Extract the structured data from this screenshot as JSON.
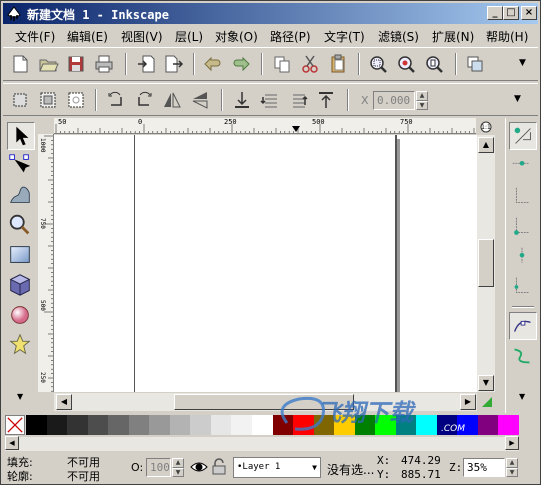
{
  "window": {
    "title": "新建文档 1 - Inkscape",
    "minimize_label": "_",
    "maximize_label": "□",
    "close_label": "×"
  },
  "menu": [
    "文件(F)",
    "编辑(E)",
    "视图(V)",
    "层(L)",
    "对象(O)",
    "路径(P)",
    "文字(T)",
    "滤镜(S)",
    "扩展(N)",
    "帮助(H)"
  ],
  "command_bar": {
    "icons": [
      "new-document-icon",
      "open-icon",
      "save-icon",
      "print-icon",
      "import-icon",
      "export-icon",
      "undo-icon",
      "redo-icon",
      "copy-icon",
      "cut-icon",
      "paste-icon",
      "zoom-selection-icon",
      "zoom-drawing-icon",
      "zoom-page-icon",
      "duplicate-icon"
    ],
    "overflow_label": "▼"
  },
  "tool_controls": {
    "icons": [
      "select-all-icon",
      "select-all-layers-icon",
      "deselect-icon",
      "rotate-ccw-icon",
      "rotate-cw-icon",
      "flip-horizontal-icon",
      "flip-vertical-icon",
      "lower-to-bottom-icon",
      "lower-icon",
      "raise-icon",
      "raise-to-top-icon"
    ],
    "x_label": "X",
    "x_value": "0.000",
    "overflow_label": "▼"
  },
  "toolbox": [
    "selector-tool-icon",
    "node-tool-icon",
    "tweak-tool-icon",
    "zoom-tool-icon",
    "rectangle-tool-icon",
    "3d-box-tool-icon",
    "ellipse-tool-icon",
    "star-tool-icon"
  ],
  "snapbar": [
    "snap-toggle-icon",
    "snap-bbox-icon",
    "snap-bbox-edge-icon",
    "snap-bbox-corner-icon",
    "snap-bbox-midpoint-icon",
    "snap-bbox-center-icon",
    "snap-nodes-icon",
    "snap-path-icon"
  ],
  "rulers": {
    "top_ticks": [
      "50",
      "0",
      "250",
      "500",
      "750"
    ],
    "left_ticks": [
      "1000",
      "750",
      "500",
      "250"
    ]
  },
  "palette": {
    "none_label": "X",
    "colors": [
      "#000000",
      "#1a1a1a",
      "#333333",
      "#4d4d4d",
      "#666666",
      "#808080",
      "#999999",
      "#b3b3b3",
      "#cccccc",
      "#e6e6e6",
      "#f2f2f2",
      "#ffffff",
      "#800000",
      "#ff0000",
      "#806600",
      "#ffcc00",
      "#008000",
      "#00ff00",
      "#008080",
      "#00ffff",
      "#000080",
      "#0000ff",
      "#800080",
      "#ff00ff"
    ]
  },
  "status": {
    "fill_label": "填充:",
    "fill_value": "不可用",
    "stroke_label": "轮廓:",
    "stroke_value": "不可用",
    "opacity_label": "O:",
    "opacity_value": "100",
    "layer_value": "•Layer 1",
    "message": "没有选...",
    "x_label": "X:",
    "x_value": "474.29",
    "y_label": "Y:",
    "y_value": "885.71",
    "zoom_label": "Z:",
    "zoom_value": "35%"
  },
  "watermark": {
    "text": "飞翔下载",
    "sub": ".COM"
  },
  "colors": {
    "title_start": "#0a246a",
    "title_end": "#a6caf0",
    "chrome": "#d4d0c8"
  }
}
